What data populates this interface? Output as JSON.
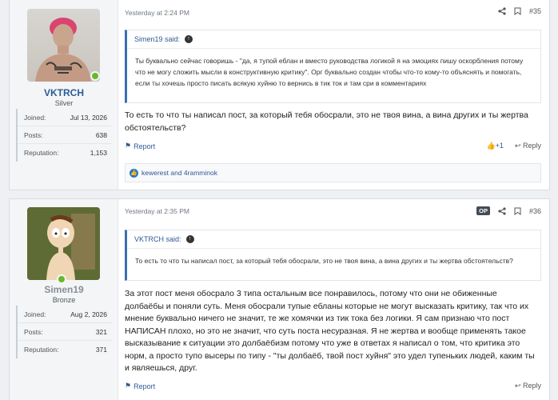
{
  "posts": [
    {
      "username": "VKTRCH",
      "username_color": "#2d5a95",
      "user_title": "Silver",
      "stats": [
        {
          "label": "Joined:",
          "value": "Jul 13, 2026"
        },
        {
          "label": "Posts:",
          "value": "638"
        },
        {
          "label": "Reputation:",
          "value": "1,153"
        }
      ],
      "time": "Yesterday at 2:24 PM",
      "number": "#35",
      "quote_author": "Simen19 said:",
      "quote_text": "Ты буквально сейчас говоришь - \"да, я тупой еблан и вместо руководства логикой я на эмоциях пишу оскорбления потому что не могу сложить мысли в конструктивную критику\". Орг буквально создан чтобы что-то кому-то объяснять и помогать, если ты хочешь просто писать всякую хуйню то вернись в тик ток и там сри в комментариях",
      "body": "То есть то что ты написал пост, за который тебя обосрали, это не твоя вина, а вина других и ты жертва обстоятельств?",
      "report_label": "Report",
      "like_count": "+1",
      "reply_label": "Reply",
      "likes_text": "kewerest and 4ramminok"
    },
    {
      "username": "Simen19",
      "username_color": "#8a8f96",
      "user_title": "Bronze",
      "op_badge": "OP",
      "stats": [
        {
          "label": "Joined:",
          "value": "Aug 2, 2026"
        },
        {
          "label": "Posts:",
          "value": "321"
        },
        {
          "label": "Reputation:",
          "value": "371"
        }
      ],
      "time": "Yesterday at 2:35 PM",
      "number": "#36",
      "quote_author": "VKTRCH said:",
      "quote_text": "То есть то что ты написал пост, за который тебя обосрали, это не твоя вина, а вина других и ты жертва обстоятельств?",
      "body": "За этот пост меня обосрало 3 типа остальным все понравилось, потому что они не обиженные долбаёбы и поняли суть. Меня обосрали тупые ебланы которые не могут высказать критику, так что их мнение буквально ничего не значит, те же хомячки из тик тока без логики. Я сам признаю что пост НАПИСАН плохо, но это не значит, что суть поста несуразная. Я не жертва и вообще применять такое высказывание к ситуации это долбаёбизм потому что уже в ответах я написал о том, что критика это норм, а просто тупо высеры по типу - \"ты долбаёб, твой пост хуйня\" это удел тупеньких людей, каким ты и являешься, друг.",
      "report_label": "Report",
      "reply_label": "Reply"
    }
  ]
}
